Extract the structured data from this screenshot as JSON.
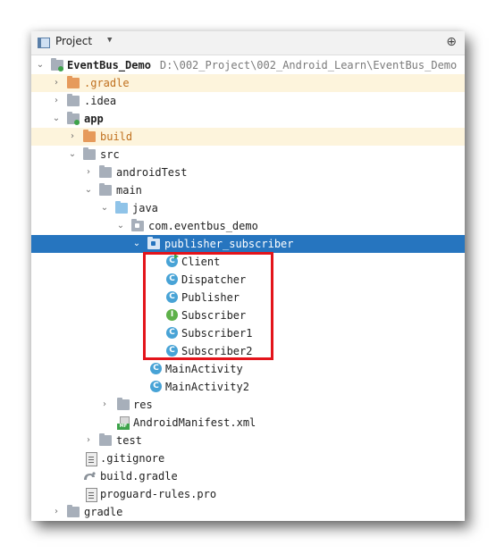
{
  "panel": {
    "title": "Project",
    "caret_icon": "chevron-down-icon",
    "settings_icon": "gear-icon"
  },
  "tree": {
    "project_name": "EventBus_Demo",
    "project_path": "D:\\002_Project\\002_Android_Learn\\EventBus_Demo",
    "items": [
      {
        "label": ".gradle"
      },
      {
        "label": ".idea"
      },
      {
        "label": "app"
      },
      {
        "label": "build"
      },
      {
        "label": "src"
      },
      {
        "label": "androidTest"
      },
      {
        "label": "main"
      },
      {
        "label": "java"
      },
      {
        "label": "com.eventbus_demo"
      },
      {
        "label": "publisher_subscriber"
      },
      {
        "label": "Client"
      },
      {
        "label": "Dispatcher"
      },
      {
        "label": "Publisher"
      },
      {
        "label": "Subscriber"
      },
      {
        "label": "Subscriber1"
      },
      {
        "label": "Subscriber2"
      },
      {
        "label": "MainActivity"
      },
      {
        "label": "MainActivity2"
      },
      {
        "label": "res"
      },
      {
        "label": "AndroidManifest.xml"
      },
      {
        "label": "test"
      },
      {
        "label": ".gitignore"
      },
      {
        "label": "build.gradle"
      },
      {
        "label": "proguard-rules.pro"
      },
      {
        "label": "gradle"
      }
    ],
    "class_badge_letter": "C",
    "interface_badge_letter": "I",
    "manifest_badge": "MF"
  },
  "colors": {
    "selection": "#2675bf",
    "excluded_tint": "#fdf4dc",
    "highlight_box": "#e3141b"
  }
}
